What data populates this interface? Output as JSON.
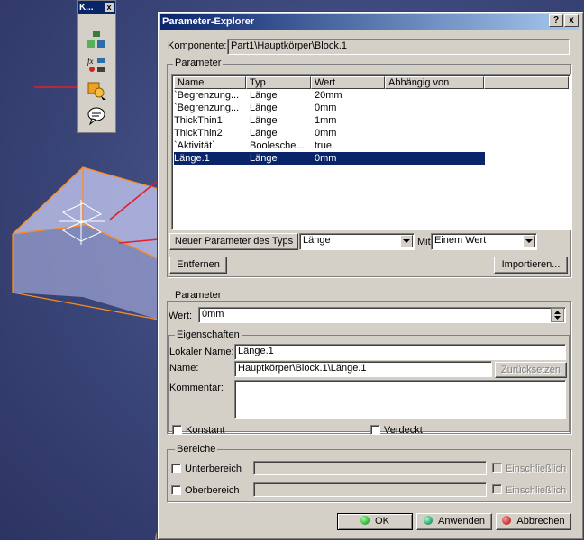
{
  "toolbar": {
    "title": "K...",
    "close": "x"
  },
  "dialog": {
    "title": "Parameter-Explorer",
    "help_btn": "?",
    "close_btn": "x",
    "komponente_label": "Komponente:",
    "komponente_value": "Part1\\Hauptkörper\\Block.1",
    "parameter_group": "Parameter",
    "columns": [
      "Name",
      "Typ",
      "Wert",
      "Abhängig von"
    ],
    "rows": [
      {
        "name": "`Begrenzung...",
        "typ": "Länge",
        "wert": "20mm"
      },
      {
        "name": "`Begrenzung...",
        "typ": "Länge",
        "wert": "0mm"
      },
      {
        "name": "ThickThin1",
        "typ": "Länge",
        "wert": "1mm"
      },
      {
        "name": "ThickThin2",
        "typ": "Länge",
        "wert": "0mm"
      },
      {
        "name": "`Aktivität`",
        "typ": "Boolesche...",
        "wert": "true"
      },
      {
        "name": "Länge.1",
        "typ": "Länge",
        "wert": "0mm",
        "selected": true
      }
    ],
    "new_param_button": "Neuer Parameter des Typs",
    "type_select": "Länge",
    "mit_label": "Mit",
    "mit_select": "Einem Wert",
    "remove_button": "Entfernen",
    "import_button": "Importieren...",
    "param2_group": "Parameter",
    "wert_label": "Wert:",
    "wert_value": "0mm",
    "props_group": "Eigenschaften",
    "local_name_label": "Lokaler Name:",
    "local_name_value": "Länge.1",
    "name_label": "Name:",
    "name_value": "Hauptkörper\\Block.1\\Länge.1",
    "reset_button": "Zurücksetzen",
    "comment_label": "Kommentar:",
    "comment_value": "",
    "konstant_label": "Konstant",
    "verdeckt_label": "Verdeckt",
    "ranges_group": "Bereiche",
    "lower_label": "Unterbereich",
    "upper_label": "Oberbereich",
    "inclusive_label": "Einschließlich",
    "ok_button": "OK",
    "apply_button": "Anwenden",
    "cancel_button": "Abbrechen"
  },
  "colors": {
    "accent": "#0a246a",
    "arrow": "#e0202a",
    "edge": "#ff8c1a"
  }
}
